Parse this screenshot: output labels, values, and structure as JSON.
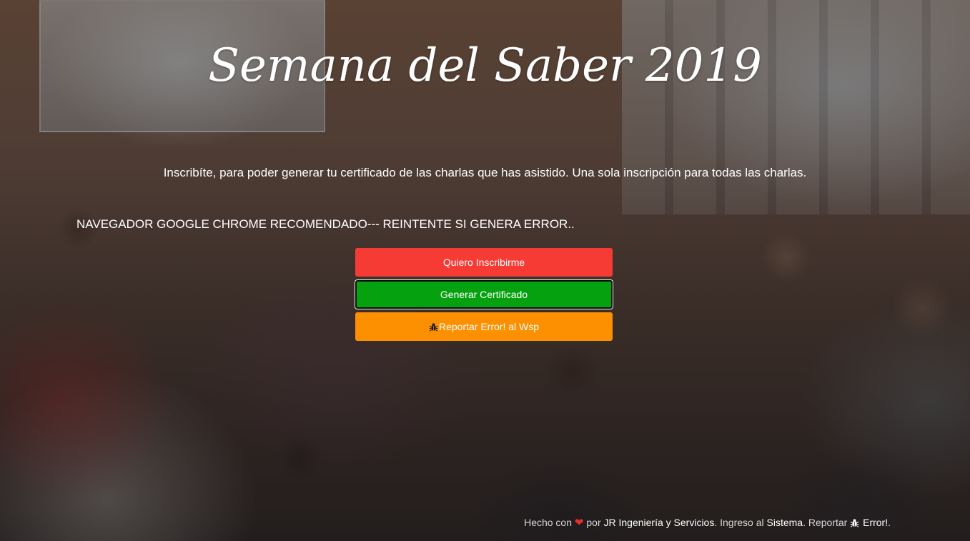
{
  "hero": {
    "title": "Semana del Saber 2019",
    "subtitle": "Inscribíte, para poder generar tu certificado de las charlas que has asistido. Una sola inscripción para todas las charlas.",
    "notice": "NAVEGADOR GOOGLE CHROME RECOMENDADO--- REINTENTE SI GENERA ERROR.."
  },
  "actions": {
    "inscribirme_label": "Quiero Inscribirme",
    "certificado_label": "Generar Certificado",
    "reportar_label": "Reportar Error! al Wsp",
    "reportar_icon": "bug-icon"
  },
  "footer": {
    "made_with": "Hecho con",
    "heart_icon": "heart-icon",
    "por": "por",
    "company_link": "JR Ingeniería y Servicios",
    "sep1": ". Ingreso al",
    "sistema_link": "Sistema",
    "sep2": ". Reportar",
    "bug_icon": "bug-icon",
    "error_link": "Error!",
    "end": "."
  },
  "colors": {
    "inscribirme": "#f63b35",
    "certificado": "#06a10f",
    "reportar": "#fc9000",
    "heart": "#e0312c"
  }
}
